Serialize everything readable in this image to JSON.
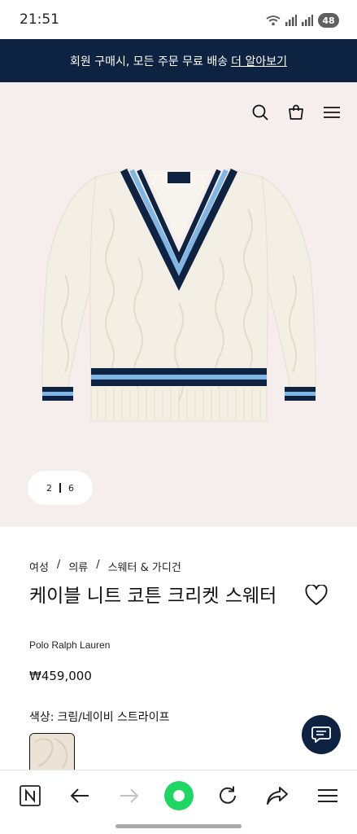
{
  "status_bar": {
    "time": "21:51",
    "battery": "48"
  },
  "promo": {
    "text": "회원 구매시, 모든 주문 무료 배송",
    "link": "더 알아보기"
  },
  "hero": {
    "icons": [
      "search-icon",
      "shopping-bag-icon",
      "menu-icon"
    ],
    "pager": {
      "current": "2",
      "total": "6"
    }
  },
  "product": {
    "breadcrumb": [
      "여성",
      "의류",
      "스웨터 & 가디건"
    ],
    "breadcrumb_separator": "/",
    "title": "케이블 니트 코튼 크리켓 스웨터",
    "brand": "Polo Ralph Lauren",
    "price": "₩459,000",
    "color_label": "색상:",
    "color_value": "크림/네이비 스트라이프"
  },
  "browser": {
    "icons": [
      "naver-n-icon",
      "back-arrow-icon",
      "forward-arrow-icon",
      "home-dot-icon",
      "refresh-icon",
      "share-icon",
      "menu-icon"
    ]
  },
  "colors": {
    "navy": "#0e2241",
    "hero_bg": "#f6eded",
    "green": "#1fd662",
    "sweater_cream": "#f3efe4",
    "stripe_blue": "#7fb6e4"
  }
}
